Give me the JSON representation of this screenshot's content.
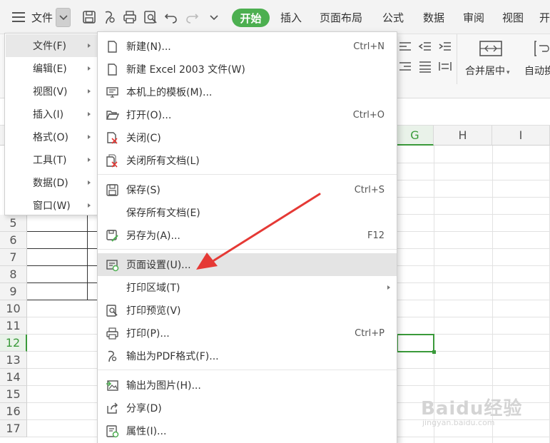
{
  "toolbar": {
    "file_label": "文件",
    "tabs": [
      "开始",
      "插入",
      "页面布局",
      "公式",
      "数据",
      "审阅",
      "视图",
      "开"
    ]
  },
  "ribbon": {
    "merge_label": "合并居中",
    "wrap_label": "自动换"
  },
  "sheet": {
    "columns": [
      "G",
      "H",
      "I"
    ],
    "rows": [
      "5",
      "6",
      "7",
      "8",
      "9",
      "10",
      "11",
      "12",
      "13",
      "14",
      "15",
      "16",
      "17"
    ]
  },
  "main_menu": {
    "items": [
      "文件(F)",
      "编辑(E)",
      "视图(V)",
      "插入(I)",
      "格式(O)",
      "工具(T)",
      "数据(D)",
      "窗口(W)"
    ]
  },
  "file_menu": {
    "new": {
      "label": "新建(N)...",
      "shortcut": "Ctrl+N"
    },
    "new_2003": {
      "label": "新建 Excel 2003 文件(W)"
    },
    "templates": {
      "label": "本机上的模板(M)..."
    },
    "open": {
      "label": "打开(O)...",
      "shortcut": "Ctrl+O"
    },
    "close": {
      "label": "关闭(C)"
    },
    "close_all": {
      "label": "关闭所有文档(L)"
    },
    "save": {
      "label": "保存(S)",
      "shortcut": "Ctrl+S"
    },
    "save_all": {
      "label": "保存所有文档(E)"
    },
    "save_as": {
      "label": "另存为(A)...",
      "shortcut": "F12"
    },
    "page_setup": {
      "label": "页面设置(U)..."
    },
    "print_area": {
      "label": "打印区域(T)"
    },
    "print_preview": {
      "label": "打印预览(V)"
    },
    "print": {
      "label": "打印(P)...",
      "shortcut": "Ctrl+P"
    },
    "export_pdf": {
      "label": "输出为PDF格式(F)..."
    },
    "export_image": {
      "label": "输出为图片(H)..."
    },
    "share": {
      "label": "分享(D)"
    },
    "properties": {
      "label": "属性(I)..."
    }
  },
  "watermark": {
    "main": "Baidu经验",
    "sub": "jingyan.baidu.com"
  },
  "colors": {
    "accent": "#4caf50",
    "arrow": "#e53935"
  }
}
